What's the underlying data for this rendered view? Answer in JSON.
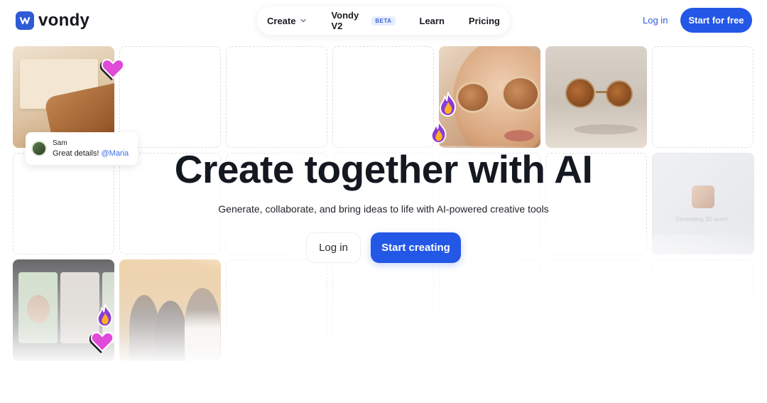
{
  "brand": {
    "name": "vondy",
    "color": "#2f5bd6"
  },
  "nav": {
    "items": [
      {
        "label": "Create",
        "has_dropdown": true
      },
      {
        "label": "Vondy V2",
        "badge": "BETA"
      },
      {
        "label": "Learn"
      },
      {
        "label": "Pricing"
      }
    ]
  },
  "header": {
    "login_label": "Log in",
    "start_label": "Start for free"
  },
  "hero": {
    "title": "Create together with AI",
    "subtitle": "Generate, collaborate, and bring ideas to life with AI-powered creative tools",
    "login_label": "Log in",
    "start_label": "Start creating"
  },
  "comment": {
    "author": "Sam",
    "text": "Great details!",
    "mention": "@Maria"
  },
  "generating": {
    "text": "Generating 3D asset..."
  },
  "colors": {
    "accent": "#2357e6",
    "heart": "#e04ad8",
    "fire": "#ffb020"
  },
  "icons": [
    "logo-icon",
    "chevron-down-icon",
    "heart-icon",
    "fire-icon"
  ]
}
